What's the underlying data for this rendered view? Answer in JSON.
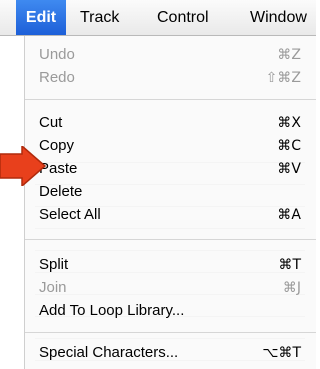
{
  "menubar": {
    "items": [
      {
        "label": "Edit"
      },
      {
        "label": "Track"
      },
      {
        "label": "Control"
      },
      {
        "label": "Window"
      }
    ]
  },
  "edit_menu": {
    "items": [
      {
        "label": "Undo",
        "shortcut": "⌘Z",
        "enabled": false
      },
      {
        "label": "Redo",
        "shortcut": "⇧⌘Z",
        "enabled": false
      },
      {
        "label": "Cut",
        "shortcut": "⌘X",
        "enabled": true
      },
      {
        "label": "Copy",
        "shortcut": "⌘C",
        "enabled": true
      },
      {
        "label": "Paste",
        "shortcut": "⌘V",
        "enabled": true
      },
      {
        "label": "Delete",
        "shortcut": "",
        "enabled": true
      },
      {
        "label": "Select All",
        "shortcut": "⌘A",
        "enabled": true
      },
      {
        "label": "Split",
        "shortcut": "⌘T",
        "enabled": true
      },
      {
        "label": "Join",
        "shortcut": "⌘J",
        "enabled": false
      },
      {
        "label": "Add To Loop Library...",
        "shortcut": "",
        "enabled": true
      },
      {
        "label": "Special Characters...",
        "shortcut": "⌥⌘T",
        "enabled": true
      }
    ]
  },
  "colors": {
    "highlight": "#2a6fe3",
    "arrow": "#e8401c",
    "disabled_text": "#9a9a9a"
  }
}
